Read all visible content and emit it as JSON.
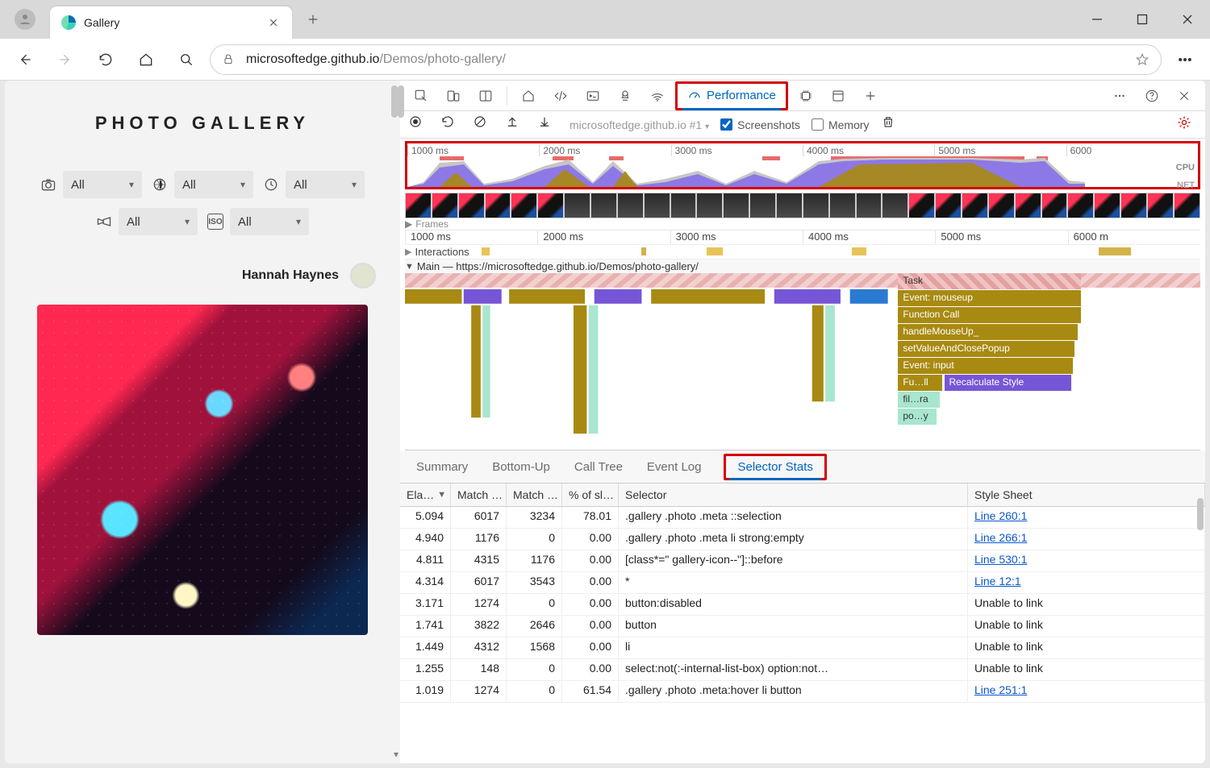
{
  "browser": {
    "tab_title": "Gallery",
    "url_host": "microsoftedge.github.io",
    "url_path": "/Demos/photo-gallery/"
  },
  "site": {
    "title": "PHOTO GALLERY",
    "filter_all": "All",
    "author": "Hannah Haynes"
  },
  "devtools": {
    "panel_label": "Performance",
    "recording_label": "microsoftedge.github.io #1",
    "screenshots_label": "Screenshots",
    "memory_label": "Memory",
    "overview_ticks": [
      "1000 ms",
      "2000 ms",
      "3000 ms",
      "4000 ms",
      "5000 ms",
      "6000"
    ],
    "cpu_label": "CPU",
    "net_label": "NET",
    "frames_label": "Frames",
    "ruler_ticks": [
      "1000 ms",
      "2000 ms",
      "3000 ms",
      "4000 ms",
      "5000 ms",
      "6000 m"
    ],
    "interactions_label": "Interactions",
    "main_label": "Main — https://microsoftedge.github.io/Demos/photo-gallery/",
    "flame_labels": {
      "task": "Task",
      "mouseup": "Event: mouseup",
      "fcall": "Function Call",
      "handle": "handleMouseUp_",
      "setval": "setValueAndClosePopup",
      "input": "Event: input",
      "full": "Fu…ll",
      "recalc": "Recalculate Style",
      "filra": "fil…ra",
      "poy": "po…y"
    },
    "tabs": [
      "Summary",
      "Bottom-Up",
      "Call Tree",
      "Event Log",
      "Selector Stats"
    ],
    "columns": [
      "Ela…",
      "Match …",
      "Match …",
      "% of sl…",
      "Selector",
      "Style Sheet"
    ],
    "rows": [
      {
        "elapsed": "5.094",
        "attempts": "6017",
        "count": "3234",
        "pct": "78.01",
        "selector": ".gallery .photo .meta ::selection",
        "sheet": "Line 260:1",
        "link": true
      },
      {
        "elapsed": "4.940",
        "attempts": "1176",
        "count": "0",
        "pct": "0.00",
        "selector": ".gallery .photo .meta li strong:empty",
        "sheet": "Line 266:1",
        "link": true
      },
      {
        "elapsed": "4.811",
        "attempts": "4315",
        "count": "1176",
        "pct": "0.00",
        "selector": "[class*=\" gallery-icon--\"]::before",
        "sheet": "Line 530:1",
        "link": true
      },
      {
        "elapsed": "4.314",
        "attempts": "6017",
        "count": "3543",
        "pct": "0.00",
        "selector": "*",
        "sheet": "Line 12:1",
        "link": true
      },
      {
        "elapsed": "3.171",
        "attempts": "1274",
        "count": "0",
        "pct": "0.00",
        "selector": "button:disabled",
        "sheet": "Unable to link",
        "link": false
      },
      {
        "elapsed": "1.741",
        "attempts": "3822",
        "count": "2646",
        "pct": "0.00",
        "selector": "button",
        "sheet": "Unable to link",
        "link": false
      },
      {
        "elapsed": "1.449",
        "attempts": "4312",
        "count": "1568",
        "pct": "0.00",
        "selector": "li",
        "sheet": "Unable to link",
        "link": false
      },
      {
        "elapsed": "1.255",
        "attempts": "148",
        "count": "0",
        "pct": "0.00",
        "selector": "select:not(:-internal-list-box) option:not…",
        "sheet": "Unable to link",
        "link": false
      },
      {
        "elapsed": "1.019",
        "attempts": "1274",
        "count": "0",
        "pct": "61.54",
        "selector": ".gallery .photo .meta:hover li button",
        "sheet": "Line 251:1",
        "link": true
      }
    ]
  }
}
